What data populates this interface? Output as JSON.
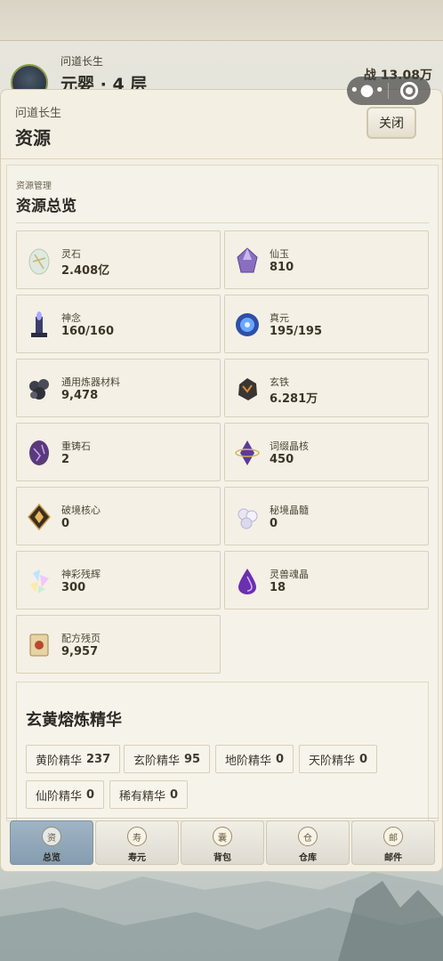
{
  "player": {
    "title": "问道长生",
    "realm": "元婴 · 4 层",
    "power": "战 13.08万"
  },
  "modal": {
    "subtitle": "问道长生",
    "title": "资源",
    "close_label": "关闭"
  },
  "panel": {
    "subtitle": "资源管理",
    "title": "资源总览"
  },
  "resources": [
    {
      "name": "灵石",
      "value": "2.408亿",
      "icon": "spirit-stone-icon"
    },
    {
      "name": "仙玉",
      "value": "810",
      "icon": "immortal-jade-icon"
    },
    {
      "name": "神念",
      "value": "160/160",
      "icon": "divine-sense-icon"
    },
    {
      "name": "真元",
      "value": "195/195",
      "icon": "true-essence-icon"
    },
    {
      "name": "通用炼器材料",
      "value": "9,478",
      "icon": "forging-material-icon"
    },
    {
      "name": "玄铁",
      "value": "6.281万",
      "icon": "dark-iron-icon"
    },
    {
      "name": "重铸石",
      "value": "2",
      "icon": "reforge-stone-icon"
    },
    {
      "name": "词缀晶核",
      "value": "450",
      "icon": "affix-crystal-icon"
    },
    {
      "name": "破境核心",
      "value": "0",
      "icon": "breakthrough-core-icon"
    },
    {
      "name": "秘境晶髓",
      "value": "0",
      "icon": "realm-crystal-icon"
    },
    {
      "name": "神彩残辉",
      "value": "300",
      "icon": "radiance-shard-icon"
    },
    {
      "name": "灵兽魂晶",
      "value": "18",
      "icon": "beast-soul-icon"
    },
    {
      "name": "配方残页",
      "value": "9,957",
      "icon": "recipe-scroll-icon"
    }
  ],
  "essence": {
    "title": "玄黄熔炼精华",
    "items": [
      {
        "name": "黄阶精华",
        "value": "237"
      },
      {
        "name": "玄阶精华",
        "value": "95"
      },
      {
        "name": "地阶精华",
        "value": "0"
      },
      {
        "name": "天阶精华",
        "value": "0"
      },
      {
        "name": "仙阶精华",
        "value": "0"
      },
      {
        "name": "稀有精华",
        "value": "0"
      }
    ]
  },
  "tabs": [
    {
      "icon_char": "资",
      "label": "总览",
      "active": true
    },
    {
      "icon_char": "寿",
      "label": "寿元",
      "active": false
    },
    {
      "icon_char": "囊",
      "label": "背包",
      "active": false
    },
    {
      "icon_char": "仓",
      "label": "仓库",
      "active": false
    },
    {
      "icon_char": "邮",
      "label": "邮件",
      "active": false
    }
  ],
  "colors": {
    "accent_active_tab": "#869db0",
    "card_border": "#d9d0b7",
    "modal_bg": "#f3efe3"
  }
}
